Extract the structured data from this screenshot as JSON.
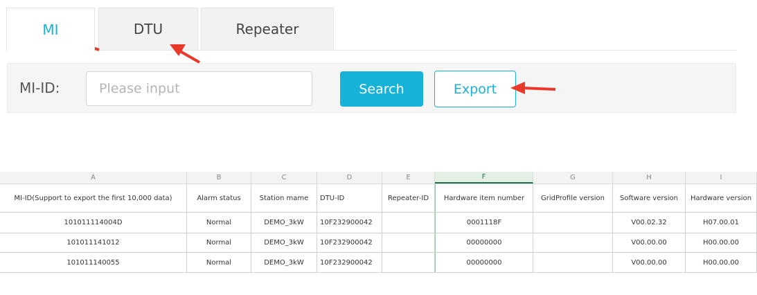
{
  "tabs": [
    {
      "label": "MI",
      "active": true
    },
    {
      "label": "DTU",
      "active": false
    },
    {
      "label": "Repeater",
      "active": false
    }
  ],
  "search": {
    "label": "MI-ID:",
    "placeholder": "Please input",
    "value": "",
    "search_label": "Search",
    "export_label": "Export"
  },
  "sheet": {
    "column_letters": [
      "A",
      "B",
      "C",
      "D",
      "E",
      "F",
      "G",
      "H",
      "I"
    ],
    "selected_column": "F",
    "headers": [
      "MI-ID(Support to export the first 10,000 data)",
      "Alarm status",
      "Station mame",
      "DTU-ID",
      "Repeater-ID",
      "Hardware item number",
      "GridProfile version",
      "Software version",
      "Hardware version"
    ],
    "rows": [
      [
        "101011114004D",
        "Normal",
        "DEMO_3kW",
        "10F232900042",
        "",
        "0001118F",
        "",
        "V00.02.32",
        "H07.00.01"
      ],
      [
        "101011141012",
        "Normal",
        "DEMO_3kW",
        "10F232900042",
        "",
        "00000000",
        "",
        "V00.00.00",
        "H00.00.00"
      ],
      [
        "101011140055",
        "Normal",
        "DEMO_3kW",
        "10F232900042",
        "",
        "00000000",
        "",
        "V00.00.00",
        "H00.00.00"
      ]
    ]
  },
  "colors": {
    "accent": "#1ab1d5",
    "arrow": "#e8392b",
    "selected_column": "#217346"
  }
}
